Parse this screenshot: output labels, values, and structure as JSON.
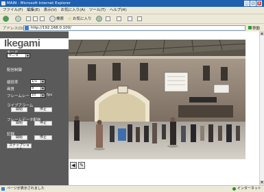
{
  "window": {
    "title": "MAIN - Microsoft Internet Explorer",
    "controls": [
      "_",
      "□",
      "x"
    ]
  },
  "menu": [
    "ファイル(F)",
    "編集(E)",
    "表示(V)",
    "お気に入り(A)",
    "ツール(T)",
    "ヘルプ(H)"
  ],
  "toolbar": {
    "search_label": "検索",
    "favorites_label": "お気に入り"
  },
  "address": {
    "label": "アドレス(D)",
    "value": "http://192.168.0.100/",
    "go_label": "移動"
  },
  "sidebar": {
    "logo": "Ikegami",
    "mode_label": "モード",
    "mode_value": "モニタ",
    "settings_label": "配信制御",
    "compression_label": "縮倍率",
    "compression_value": "1/1",
    "quality_label": "画質",
    "quality_value": "8",
    "framerate_label": "フレームレート",
    "framerate_value": "10",
    "framerate_unit": "fps",
    "live_alarm_label": "ライブアラーム",
    "frame_data_label": "フレームデータ配信",
    "record_label": "記録",
    "start_label": "開始",
    "stop_label": "停止",
    "snapshot_label": "スナップショット"
  },
  "controls": {
    "prev_icon": "speaker-icon",
    "next_icon": "pencil-icon"
  },
  "status": {
    "left": "ページが表示されました",
    "right": "インターネット"
  }
}
